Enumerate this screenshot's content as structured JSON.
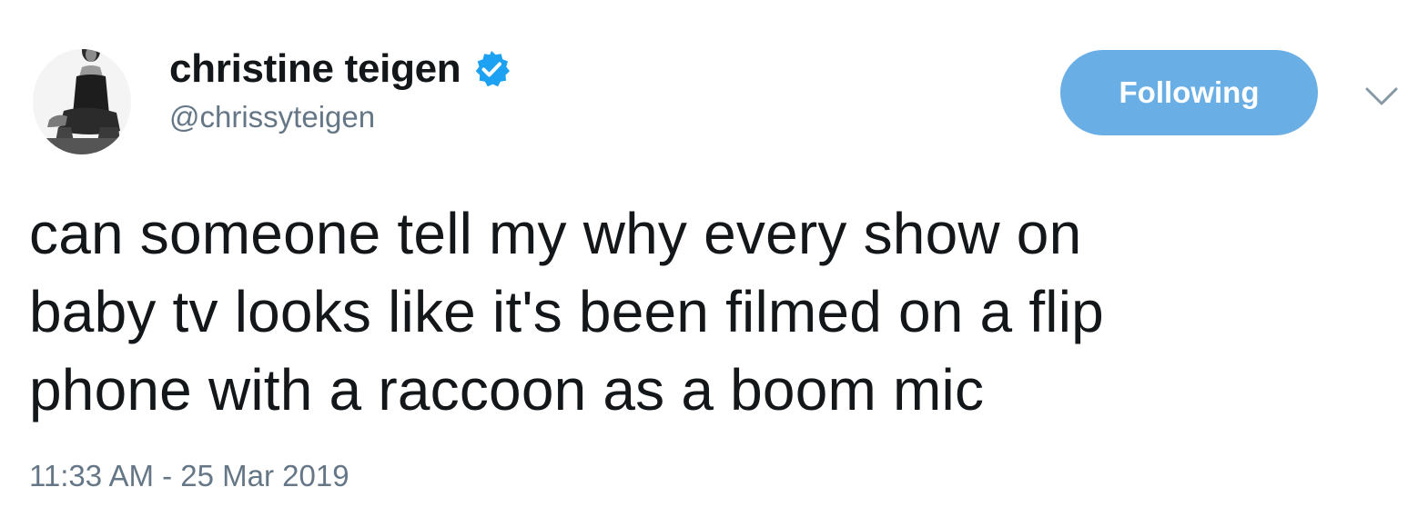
{
  "tweet": {
    "author": {
      "display_name": "christine teigen",
      "handle": "@chrissyteigen",
      "verified": true,
      "avatar": "profile-photo"
    },
    "follow_button": {
      "label": "Following",
      "color": "#6aaee6"
    },
    "menu_icon": "chevron-down-icon",
    "verified_icon": "verified-badge-icon",
    "verified_color": "#1da1f2",
    "text": "can someone tell my why every show on\nbaby tv looks like it's been filmed on a flip\nphone with a raccoon as a boom mic",
    "timestamp": "11:33 AM - 25 Mar 2019"
  }
}
